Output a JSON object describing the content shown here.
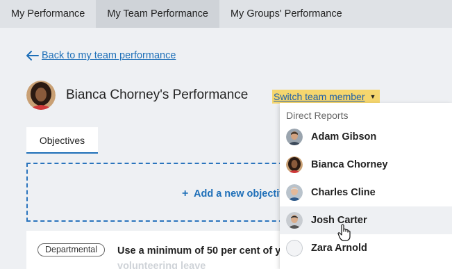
{
  "topnav": {
    "tabs": [
      {
        "label": "My Performance",
        "active": false
      },
      {
        "label": "My Team Performance",
        "active": true
      },
      {
        "label": "My Groups' Performance",
        "active": false
      }
    ]
  },
  "back_link": {
    "label": "Back to my team performance",
    "icon": "arrow-left-icon"
  },
  "header": {
    "title": "Bianca Chorney's Performance",
    "avatar": "avatar-bianca"
  },
  "switch_member": {
    "label": "Switch team member",
    "icon": "caret-down-icon",
    "highlight": "#f5d66e"
  },
  "tabs": [
    {
      "label": "Objectives",
      "active": true
    }
  ],
  "add_objective": {
    "label": "Add a new objective",
    "icon": "plus-icon"
  },
  "objective": {
    "badge": "Departmental",
    "text": "Use a minimum of 50 per cent of y",
    "text_line2": "volunteering leave"
  },
  "dropdown": {
    "header": "Direct Reports",
    "items": [
      {
        "name": "Adam Gibson",
        "avatar": "avatar-adam"
      },
      {
        "name": "Bianca Chorney",
        "avatar": "avatar-bianca"
      },
      {
        "name": "Charles Cline",
        "avatar": "avatar-charles"
      },
      {
        "name": "Josh Carter",
        "avatar": "avatar-josh",
        "hover": true
      },
      {
        "name": "Zara Arnold",
        "avatar": "avatar-placeholder"
      }
    ]
  },
  "colors": {
    "accent": "#1e6fb8",
    "highlight": "#f5d66e",
    "background": "#eef0f3"
  }
}
